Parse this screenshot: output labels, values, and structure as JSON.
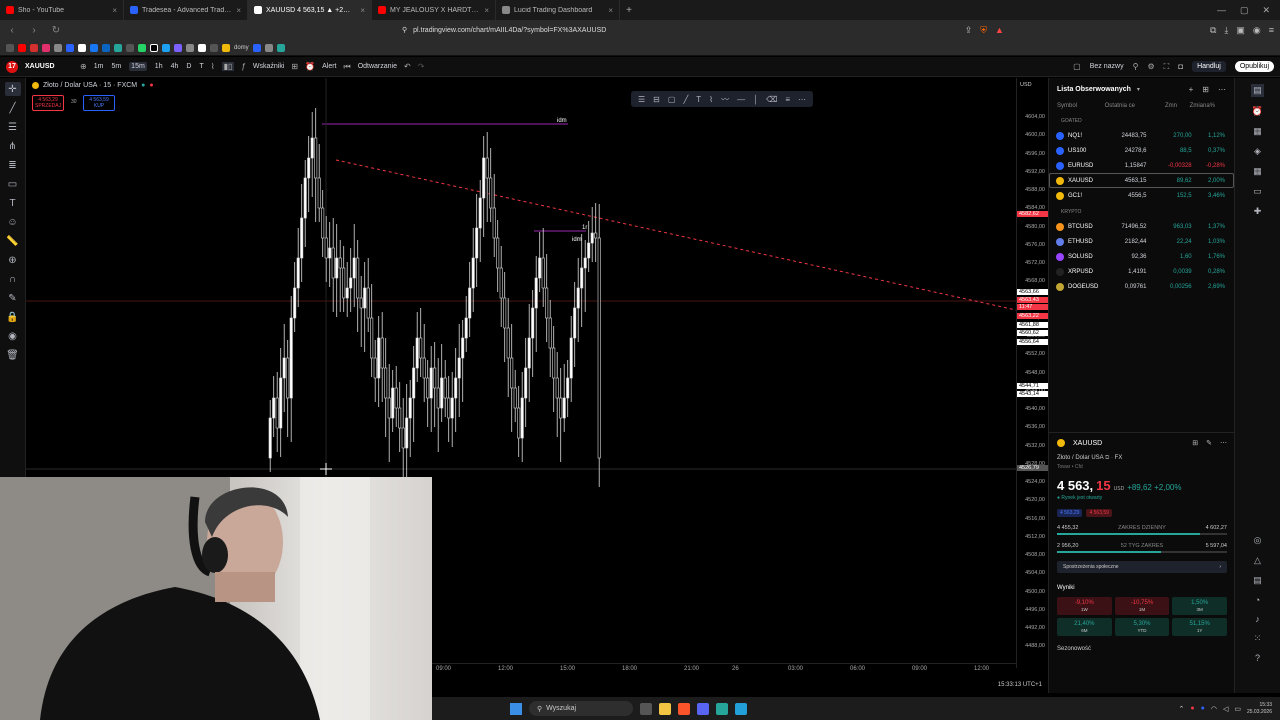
{
  "browser": {
    "tabs": [
      {
        "label": "Sho - YouTube",
        "color": "#ff0000",
        "active": false
      },
      {
        "label": "Tradesea - Advanced Trading Dashb",
        "color": "#2962ff",
        "active": false
      },
      {
        "label": "XAUUSD 4 563,15 ▲ +2% Bez n",
        "color": "#ffffff",
        "active": true
      },
      {
        "label": "MY JEALOUSY X HARDTEKK (OLD VI",
        "color": "#ff0000",
        "active": false
      },
      {
        "label": "Lucid Trading Dashboard",
        "color": "#888888",
        "active": false
      }
    ],
    "new_tab": "+",
    "url": "pl.tradingview.com/chart/mAIIL4Da/?symbol=FX%3AXAUUSD",
    "bookmark_folder": "domy"
  },
  "toolbar": {
    "logo": "17",
    "symbol": "XAUUSD",
    "timeframes": [
      "1m",
      "5m",
      "15m",
      "1h",
      "4h",
      "D",
      "T"
    ],
    "selected_timeframe": "15m",
    "indicators_label": "Wskaźniki",
    "alert_label": "Alert",
    "replay_label": "Odtwarzanie",
    "layout_name": "Bez nazwy",
    "trade_label": "Handluj",
    "publish_label": "Opublikuj"
  },
  "chart": {
    "legend_title": "Złoto / Dolar USA · 15 · FXCM",
    "sell_price": "4 563,29",
    "sell_label": "SPRZEDAJ",
    "buy_price": "4 563,59",
    "buy_label": "KUP",
    "spread": "30",
    "axis_unit": "USD",
    "price_ticks": [
      "4604,00",
      "4600,00",
      "4596,00",
      "4592,00",
      "4588,00",
      "4584,00",
      "4580,00",
      "4576,00",
      "4572,00",
      "4568,00",
      "4564,00",
      "4560,00",
      "4556,00",
      "4552,00",
      "4548,00",
      "4544,00",
      "4540,00",
      "4536,00",
      "4532,00",
      "4528,00",
      "4524,00",
      "4520,00",
      "4516,00",
      "4512,00",
      "4508,00",
      "4504,00",
      "4500,00",
      "4496,00",
      "4492,00",
      "4488,00"
    ],
    "price_labels": [
      {
        "text": "4582,62",
        "color": "#f23645"
      },
      {
        "text": "4563,66",
        "color": "#ffffff"
      },
      {
        "text": "4563,43",
        "color": "#f23645"
      },
      {
        "text": "11:47",
        "color": "#f23645"
      },
      {
        "text": "4563,22",
        "color": "#f23645"
      },
      {
        "text": "4561,88",
        "color": "#ffffff"
      },
      {
        "text": "4560,62",
        "color": "#ffffff"
      },
      {
        "text": "4556,64",
        "color": "#ffffff"
      },
      {
        "text": "4544,71",
        "color": "#ffffff"
      },
      {
        "text": "4543,14",
        "color": "#ffffff"
      },
      {
        "text": "4526,79",
        "color": "#555555"
      }
    ],
    "annotations": [
      "idm",
      "1r",
      "idm"
    ],
    "time_ticks": [
      "09:00",
      "12:00",
      "15:00",
      "18:00",
      "21:00",
      "26",
      "03:00",
      "06:00",
      "09:00",
      "12:00"
    ],
    "clock": "15:33:13 UTC+1"
  },
  "watchlist": {
    "title": "Lista Obserwowanych",
    "columns": [
      "Symbol",
      "Ostatnia ce",
      "Zmn",
      "Zmiana%"
    ],
    "sections": [
      {
        "name": "GOATED",
        "rows": [
          {
            "symbol": "NQ1!",
            "last": "24483,75",
            "change": "270,00",
            "pct": "1,12%",
            "dir": "pos",
            "color": "#2962ff"
          },
          {
            "symbol": "US100",
            "last": "24278,6",
            "change": "88,5",
            "pct": "0,37%",
            "dir": "pos",
            "color": "#2962ff"
          },
          {
            "symbol": "EURUSD",
            "last": "1,15847",
            "change": "-0,00328",
            "pct": "-0,28%",
            "dir": "neg",
            "color": "#2962ff"
          },
          {
            "symbol": "XAUUSD",
            "last": "4563,15",
            "change": "89,62",
            "pct": "2,00%",
            "dir": "pos",
            "color": "#f0b90b"
          },
          {
            "symbol": "GC1!",
            "last": "4556,5",
            "change": "152,5",
            "pct": "3,46%",
            "dir": "pos",
            "color": "#f0b90b"
          }
        ]
      },
      {
        "name": "KRYPTO",
        "rows": [
          {
            "symbol": "BTCUSD",
            "last": "71496,52",
            "change": "963,03",
            "pct": "1,37%",
            "dir": "pos",
            "color": "#f7931a"
          },
          {
            "symbol": "ETHUSD",
            "last": "2182,44",
            "change": "22,24",
            "pct": "1,03%",
            "dir": "pos",
            "color": "#627eea"
          },
          {
            "symbol": "SOLUSD",
            "last": "92,36",
            "change": "1,60",
            "pct": "1,76%",
            "dir": "pos",
            "color": "#9945ff"
          },
          {
            "symbol": "XRPUSD",
            "last": "1,4191",
            "change": "0,0039",
            "pct": "0,28%",
            "dir": "pos",
            "color": "#222222"
          },
          {
            "symbol": "DOGEUSD",
            "last": "0,09761",
            "change": "0,00256",
            "pct": "2,69%",
            "dir": "pos",
            "color": "#c2a633"
          }
        ]
      }
    ]
  },
  "details": {
    "symbol": "XAUUSD",
    "name": "Złoto / Dolar USA",
    "exchange": "FX",
    "type": "Towar • Cfd",
    "price_int": "4 563,",
    "price_dec": "15",
    "unit": "USD",
    "change": "+89,62 +2,00%",
    "market_status": "● Rynek jest otwarty",
    "bid": "4 563,29",
    "ask": "4 563,59",
    "day_low": "4 455,32",
    "day_high": "4 602,27",
    "day_label": "ZAKRES DZIENNY",
    "day_fraction": 0.84,
    "year_low": "2 956,20",
    "year_high": "5 597,04",
    "year_label": "52 TYG ZAKRES",
    "year_fraction": 0.61,
    "community": "Spostrzeżenia społeczne",
    "results_label": "Wyniki",
    "performance": [
      {
        "value": "-9,10%",
        "label": "1W",
        "dir": "neg"
      },
      {
        "value": "-10,75%",
        "label": "1M",
        "dir": "neg"
      },
      {
        "value": "1,50%",
        "label": "3M",
        "dir": "pos"
      },
      {
        "value": "21,40%",
        "label": "6M",
        "dir": "pos"
      },
      {
        "value": "5,30%",
        "label": "YTD",
        "dir": "pos"
      },
      {
        "value": "51,15%",
        "label": "1Y",
        "dir": "pos"
      }
    ],
    "seasonality": "Sezonowość"
  },
  "taskbar": {
    "search": "Wyszukaj",
    "time": "15:33",
    "date": "25.03.2026"
  }
}
